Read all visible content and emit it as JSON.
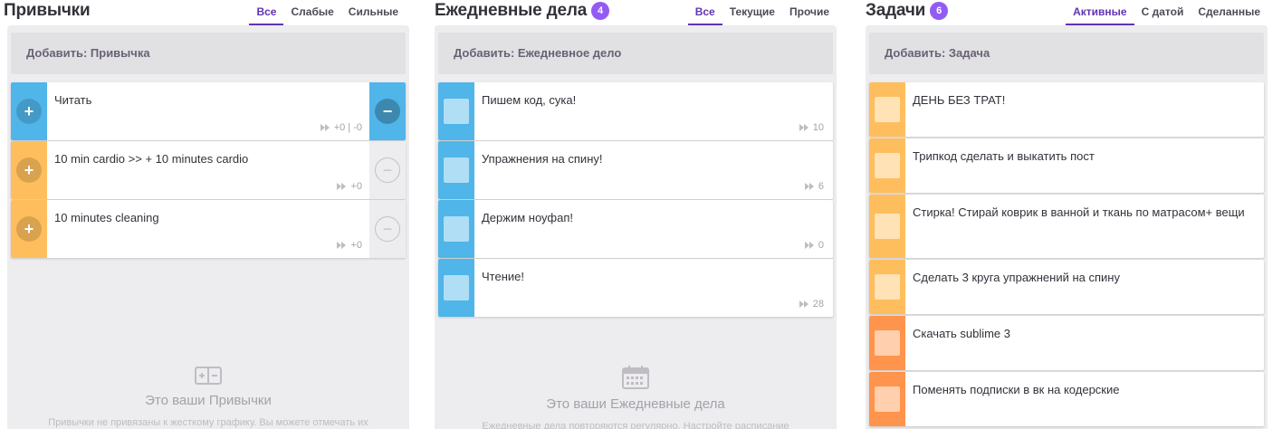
{
  "habits": {
    "title": "Привычки",
    "filters": [
      "Все",
      "Слабые",
      "Сильные"
    ],
    "add_label": "Добавить: Привычка",
    "items": [
      {
        "text": "Читать",
        "meta": "+0 | -0",
        "color": "#50b5e9",
        "minus_enabled": true
      },
      {
        "text": "10 min cardio >> + 10 minutes cardio",
        "meta": "+0",
        "color": "#ffbe5d",
        "minus_enabled": false
      },
      {
        "text": "10 minutes cleaning",
        "meta": "+0",
        "color": "#ffbe5d",
        "minus_enabled": false
      }
    ],
    "empty_title": "Это ваши Привычки",
    "empty_desc": "Привычки не привязаны к жесткому графику. Вы можете отмечать их"
  },
  "dailies": {
    "title": "Ежедневные дела",
    "count": "4",
    "filters": [
      "Все",
      "Текущие",
      "Прочие"
    ],
    "add_label": "Добавить: Ежедневное дело",
    "items": [
      {
        "text": "Пишем код, сука!",
        "meta": "10",
        "color": "#50b5e9"
      },
      {
        "text": "Упражнения на спину!",
        "meta": "6",
        "color": "#50b5e9"
      },
      {
        "text": "Держим ноуфап!",
        "meta": "0",
        "color": "#50b5e9"
      },
      {
        "text": "Чтение!",
        "meta": "28",
        "color": "#50b5e9"
      }
    ],
    "empty_title": "Это ваши Ежедневные дела",
    "empty_desc": "Ежедневные дела повторяются регулярно. Настройте расписание"
  },
  "todos": {
    "title": "Задачи",
    "count": "6",
    "filters": [
      "Активные",
      "С датой",
      "Сделанные"
    ],
    "add_label": "Добавить: Задача",
    "items": [
      {
        "text": "ДЕНЬ БЕЗ ТРАТ!",
        "color": "#ffbe5d"
      },
      {
        "text": "Трипкод сделать и выкатить пост",
        "color": "#ffbe5d"
      },
      {
        "text": "Стирка! Стирай коврик в ванной и ткань по матрасом+ вещи",
        "color": "#ffbe5d"
      },
      {
        "text": "Сделать 3 круга упражнений на спину",
        "color": "#ffbe5d"
      },
      {
        "text": "Скачать sublime 3",
        "color": "#ff944c"
      },
      {
        "text": "Поменять подписки в вк на кодерские",
        "color": "#ff944c"
      }
    ]
  }
}
